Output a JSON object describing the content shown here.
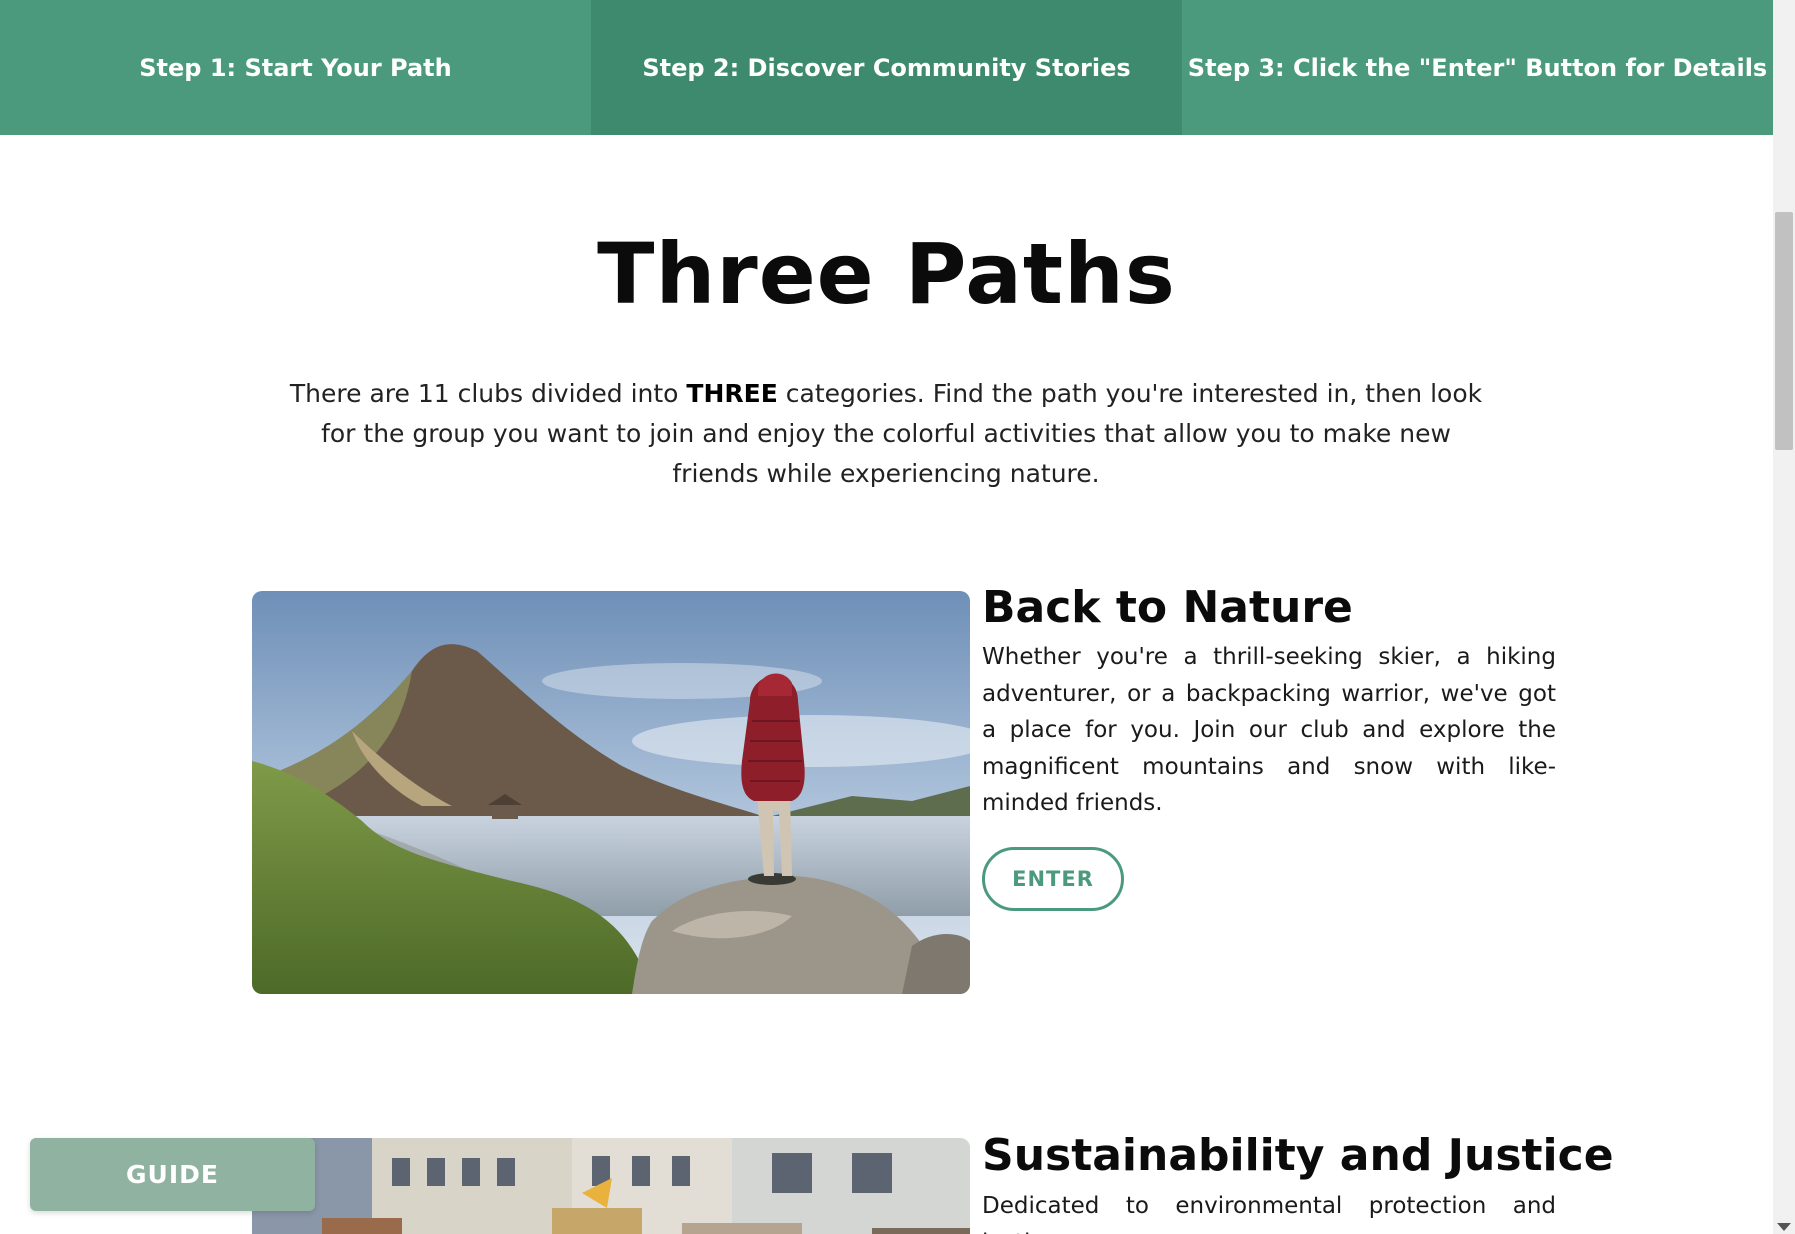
{
  "steps": [
    {
      "label": "Step 1: Start Your Path"
    },
    {
      "label": "Step 2: Discover Community Stories"
    },
    {
      "label": "Step 3: Click the \"Enter\" Button for Details"
    }
  ],
  "title": "Three Paths",
  "intro": {
    "before": "There are 11 clubs divided into ",
    "emphasis": "THREE",
    "after": " categories. Find the path you're interested in, then look for the group you want to join and enjoy the colorful activities that allow you to make new friends while experiencing nature."
  },
  "cards": [
    {
      "title": "Back to Nature",
      "description": "Whether you're a thrill-seeking skier, a hiking adventurer, or a backpacking warrior, we've got a place for you. Join our club and explore the magnificent mountains and snow with like-minded friends.",
      "button": "ENTER"
    },
    {
      "title": "Sustainability and Justice",
      "description": "Dedicated to environmental protection and justice"
    }
  ],
  "guide": {
    "label": "GUIDE"
  },
  "colors": {
    "primary": "#4c9a7d",
    "primary_dark": "#3e8a6e",
    "guide": "#8fb3a0"
  }
}
